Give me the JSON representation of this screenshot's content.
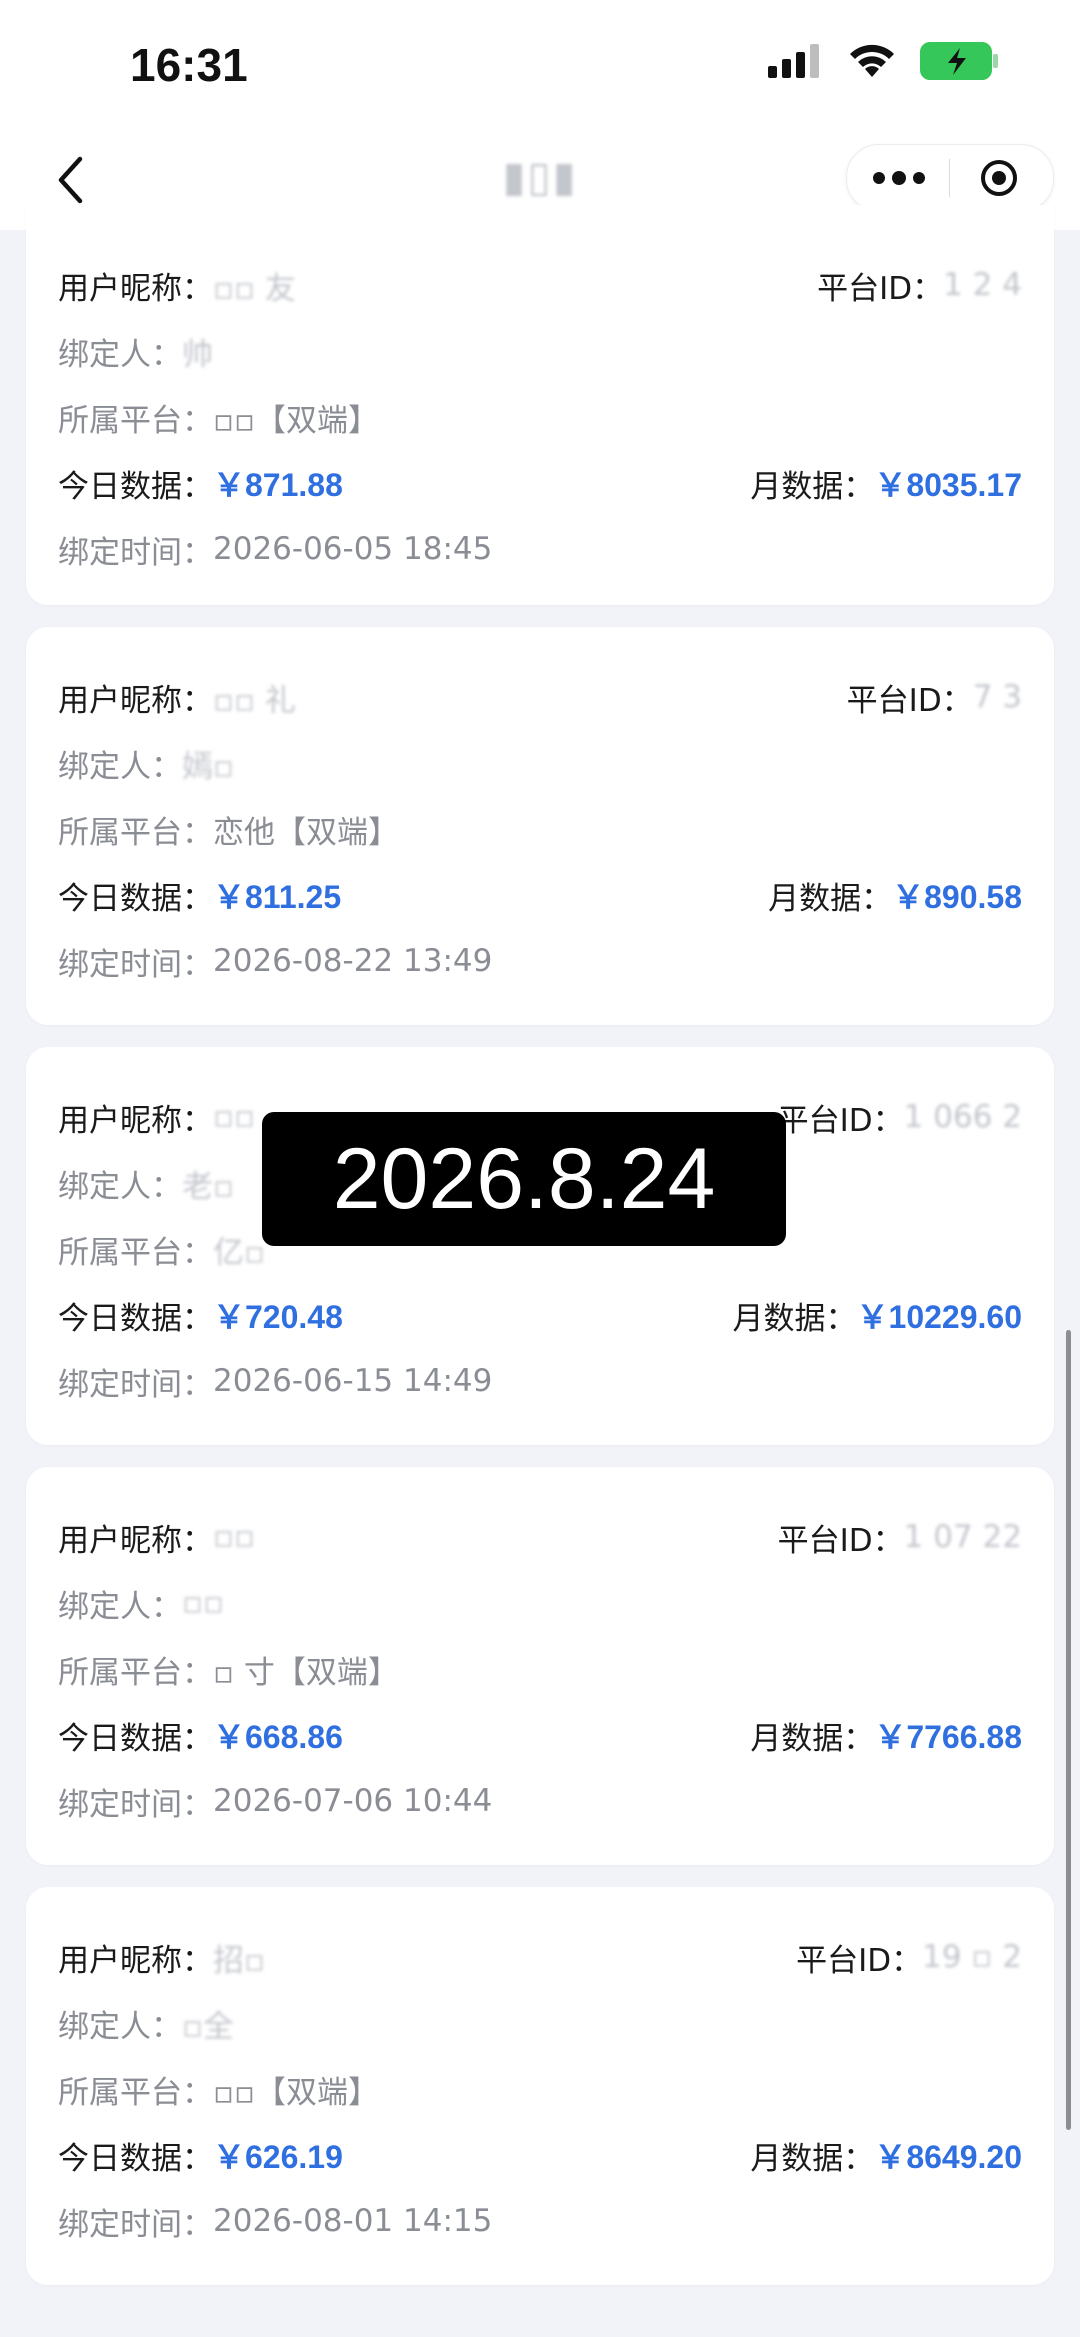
{
  "status_bar": {
    "time": "16:31"
  },
  "nav": {
    "title": "▮▯▮"
  },
  "labels": {
    "nickname": "用户昵称：",
    "platform_id": "平台ID：",
    "binder": "绑定人：",
    "platform": "所属平台：",
    "today": "今日数据：",
    "month": "月数据：",
    "bind_time": "绑定时间："
  },
  "cards": [
    {
      "nickname": "▫▫ 友",
      "platform_id": "1 2 4",
      "binder": "帅",
      "platform": "▫▫【双端】",
      "today": "￥871.88",
      "month": "￥8035.17",
      "bind_time": "2026-06-05 18:45"
    },
    {
      "nickname": "▫▫ 礼",
      "platform_id": "7 3",
      "binder": "嫣▫",
      "platform": "恋他【双端】",
      "today": "￥811.25",
      "month": "￥890.58",
      "bind_time": "2026-08-22 13:49"
    },
    {
      "nickname": "▫▫",
      "platform_id": "1 066 2",
      "binder": "老▫",
      "platform": "亿▫",
      "today": "￥720.48",
      "month": "￥10229.60",
      "bind_time": "2026-06-15 14:49"
    },
    {
      "nickname": "▫▫",
      "platform_id": "1 07 22",
      "binder": "▫▫",
      "platform": "▫ 寸【双端】",
      "today": "￥668.86",
      "month": "￥7766.88",
      "bind_time": "2026-07-06 10:44"
    },
    {
      "nickname": "招▫",
      "platform_id": "19 ▫ 2",
      "binder": "▫全",
      "platform": "▫▫【双端】",
      "today": "￥626.19",
      "month": "￥8649.20",
      "bind_time": "2026-08-01 14:15"
    }
  ],
  "overlay": {
    "date": "2026.8.24"
  },
  "colors": {
    "accent": "#2f6fe0",
    "battery": "#35c759"
  },
  "icons": [
    "signal-icon",
    "wifi-icon",
    "battery-charging-icon",
    "back-icon",
    "more-icon",
    "target-icon"
  ]
}
